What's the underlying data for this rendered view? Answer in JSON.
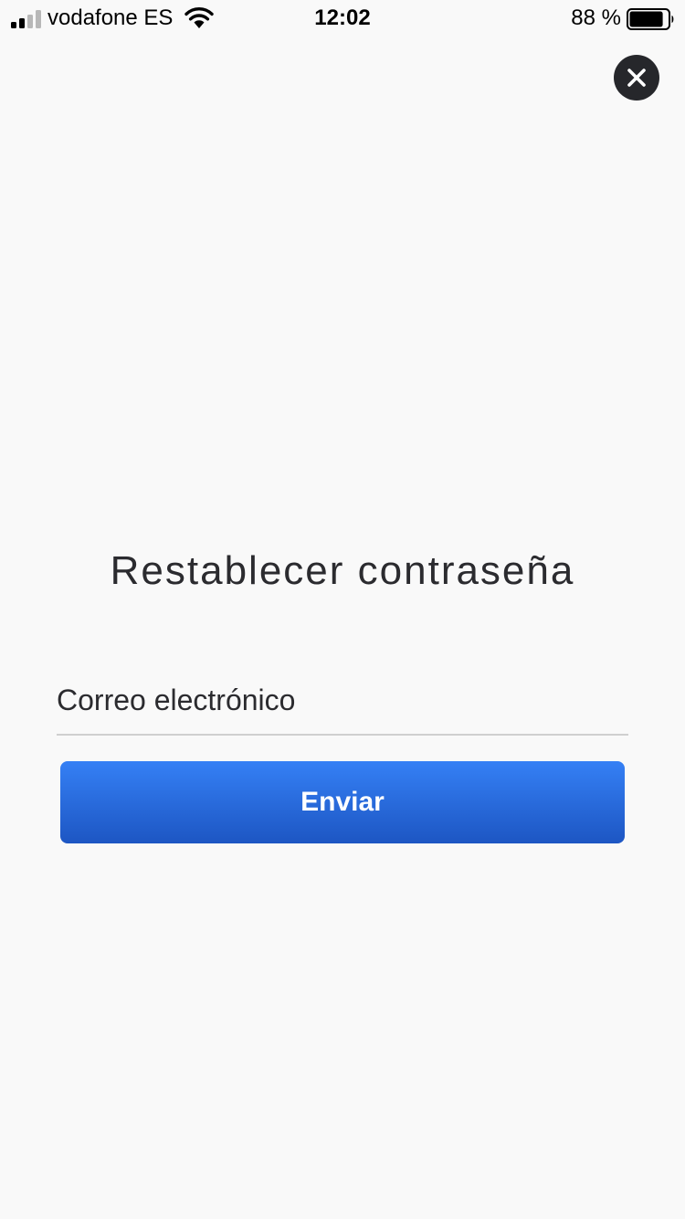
{
  "status_bar": {
    "carrier": "vodafone ES",
    "time": "12:02",
    "battery_percent": "88 %",
    "battery_level": 0.88,
    "signal_bars_filled": 2,
    "signal_bars_total": 4
  },
  "screen": {
    "title": "Restablecer contraseña",
    "email_placeholder": "Correo electrónico",
    "email_value": "",
    "submit_label": "Enviar",
    "close_icon": "close-icon"
  },
  "colors": {
    "background": "#f9f9f9",
    "text": "#2b2b2f",
    "button_top": "#3580f5",
    "button_bottom": "#1d56c3",
    "close_button": "#26272b"
  }
}
